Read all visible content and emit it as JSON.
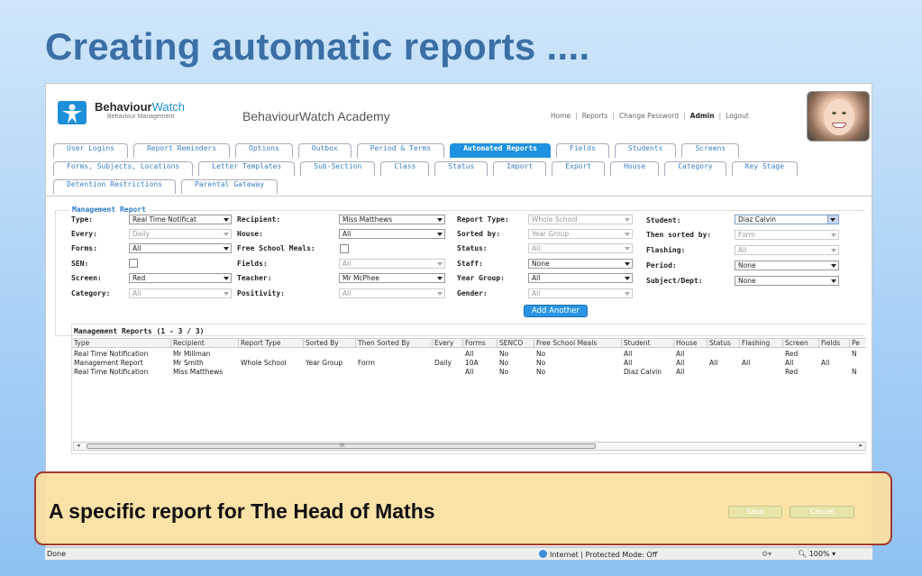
{
  "slide": {
    "title": "Creating automatic reports ...."
  },
  "header": {
    "logo_name_a": "Behaviour",
    "logo_name_b": "Watch",
    "logo_sub": "Behaviour Management",
    "academy": "BehaviourWatch Academy",
    "nav": [
      "Home",
      "Reports",
      "Change Password",
      "Admin",
      "Logout"
    ]
  },
  "tabs": {
    "row1": [
      "User Logins",
      "Report Reminders",
      "Options",
      "Outbox",
      "Period & Terms",
      "Automated Reports",
      "Fields",
      "Students",
      "Screens"
    ],
    "row2": [
      "Forms, Subjects, Locations",
      "Letter Templates",
      "Sub-Section",
      "Class",
      "Status",
      "Import",
      "Export",
      "House",
      "Category",
      "Key Stage"
    ],
    "row3": [
      "Detention Restrictions",
      "Parental Gateway"
    ],
    "active": "Automated Reports"
  },
  "form": {
    "title": "Management Report",
    "type_label": "Type:",
    "type_value": "Real Time Notificat",
    "every_label": "Every:",
    "every_value": "Daily",
    "forms_label": "Forms:",
    "forms_value": "All",
    "sen_label": "SEN:",
    "screen_label": "Screen:",
    "screen_value": "Red",
    "category_label": "Category:",
    "category_value": "All",
    "recipient_label": "Recipient:",
    "recipient_value": "Miss Matthews",
    "house_label": "House:",
    "house_value": "All",
    "fsm_label": "Free School Meals:",
    "fields_label": "Fields:",
    "fields_value": "All",
    "teacher_label": "Teacher:",
    "teacher_value": "Mr McPhee",
    "positivity_label": "Positivity:",
    "positivity_value": "All",
    "report_type_label": "Report Type:",
    "report_type_value": "Whole School",
    "sorted_by_label": "Sorted by:",
    "sorted_by_value": "Year Group",
    "status_label": "Status:",
    "status_value": "All",
    "staff_label": "Staff:",
    "staff_value": "None",
    "year_group_label": "Year Group:",
    "year_group_value": "All",
    "gender_label": "Gender:",
    "gender_value": "All",
    "student_label": "Student:",
    "student_value": "Diaz Calvin",
    "then_sorted_label": "Then sorted by:",
    "then_sorted_value": "Form",
    "flashing_label": "Flashing:",
    "flashing_value": "All",
    "period_label": "Period:",
    "period_value": "None",
    "subject_label": "Subject/Dept:",
    "subject_value": "None",
    "add_another": "Add Another"
  },
  "reports": {
    "title": "Management Reports (1 - 3 / 3)",
    "columns": [
      "Type",
      "Recipient",
      "Report Type",
      "Sorted By",
      "Then Sorted By",
      "Every",
      "Forms",
      "SENCO",
      "Free School Meals",
      "Student",
      "House",
      "Status",
      "Flashing",
      "Screen",
      "Fields",
      "Pe"
    ],
    "rows": [
      [
        "Real Time Notification",
        "Mr Millman",
        "",
        "",
        "",
        "",
        "All",
        "No",
        "No",
        "All",
        "All",
        "",
        "",
        "Red",
        "",
        "N"
      ],
      [
        "Management Report",
        "Mr Smith",
        "Whole School",
        "Year Group",
        "Form",
        "Daily",
        "10A",
        "No",
        "No",
        "All",
        "All",
        "All",
        "All",
        "All",
        "All",
        ""
      ],
      [
        "Real Time Notification",
        "Miss Matthews",
        "",
        "",
        "",
        "",
        "All",
        "No",
        "No",
        "Diaz Calvin",
        "All",
        "",
        "",
        "Red",
        "",
        "N"
      ]
    ],
    "scroll_grip": "III"
  },
  "callout": {
    "text": "A specific report for The Head of Maths",
    "save": "Save",
    "cancel": "Cancel"
  },
  "statusbar": {
    "done": "Done",
    "zone": "Internet | Protected Mode: Off",
    "zoom": "100%"
  }
}
